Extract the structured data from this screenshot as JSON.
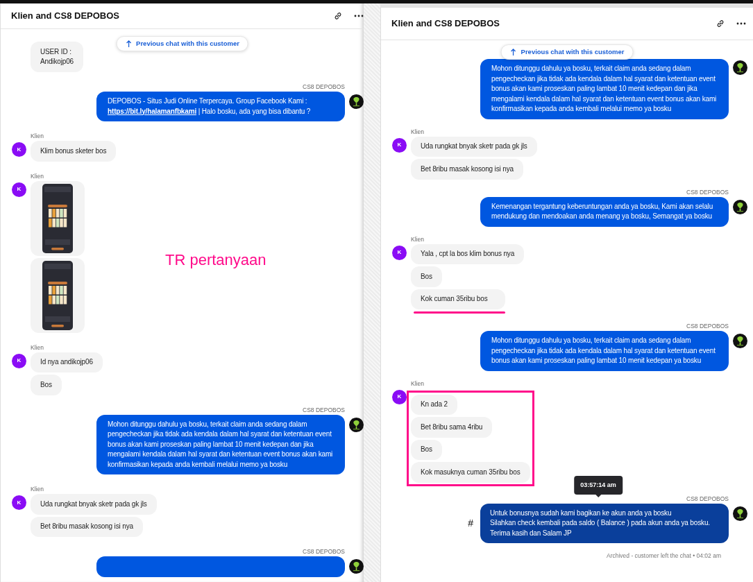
{
  "panels": [
    {
      "title": "Klien and CS8 DEPOBOS",
      "previous_chat_button": "Previous chat with this customer",
      "note": "TR pertanyaan",
      "groups": [
        {
          "kind": "client",
          "avatar": false,
          "boxed": false,
          "hovered": false,
          "bubbles": [
            {
              "kind": "text",
              "text": "USER ID :\nAndikojp06"
            }
          ]
        },
        {
          "kind": "agent",
          "avatar": true,
          "sender": "CS8 DEPOBOS",
          "boxed": false,
          "hovered": false,
          "bubbles": [
            {
              "kind": "link_text",
              "text": "DEPOBOS - Situs Judi Online Terpercaya. Group Facebook Kami :",
              "link": "https://bit.ly/halamanfbkami",
              "after": "| Halo bosku, ada yang bisa dibantu ?"
            }
          ]
        },
        {
          "kind": "client",
          "avatar": true,
          "initial": "K",
          "sender": "Klien",
          "boxed": false,
          "hovered": false,
          "bubbles": [
            {
              "kind": "text",
              "text": "Klim bonus sketer bos"
            }
          ]
        },
        {
          "kind": "client",
          "avatar": true,
          "initial": "K",
          "sender": "Klien",
          "boxed": false,
          "hovered": false
        },
        {
          "kind": "client",
          "avatar": true,
          "initial": "K",
          "sender": "Klien",
          "boxed": false,
          "hovered": false,
          "bubbles": [
            {
              "kind": "text",
              "text": "Id nya andikojp06"
            },
            {
              "kind": "text",
              "text": "Bos"
            }
          ]
        },
        {
          "kind": "agent",
          "avatar": true,
          "sender": "CS8 DEPOBOS",
          "boxed": false,
          "hovered": false,
          "bubbles": [
            {
              "kind": "text",
              "text": "Mohon ditunggu dahulu ya bosku, terkait claim anda sedang dalam pengecheckan jika tidak ada kendala dalam hal syarat dan ketentuan event bonus akan kami proseskan paling lambat 10 menit kedepan dan jika mengalami kendala dalam hal syarat dan ketentuan event bonus akan kami konfirmasikan kepada anda kembali melalui memo ya bosku"
            }
          ]
        },
        {
          "kind": "client",
          "avatar": true,
          "initial": "K",
          "sender": "Klien",
          "boxed": false,
          "hovered": false,
          "bubbles": [
            {
              "kind": "text",
              "text": "Uda rungkat bnyak sketr pada gk jls"
            },
            {
              "kind": "text",
              "text": "Bet 8ribu masak kosong isi nya"
            }
          ]
        },
        {
          "kind": "agent",
          "avatar": true,
          "sender": "CS8 DEPOBOS",
          "boxed": false,
          "hovered": false,
          "bubbles": [
            {
              "kind": "cut"
            }
          ]
        }
      ]
    },
    {
      "title": "Klien and CS8 DEPOBOS",
      "previous_chat_button": "Previous chat with this customer",
      "footer": "Archived - customer left the chat • 04:02 am",
      "groups": [
        {
          "kind": "agent",
          "avatar": true,
          "boxed": false,
          "hovered": false,
          "bubbles": [
            {
              "kind": "text",
              "text": "Mohon ditunggu dahulu ya bosku, terkait claim anda sedang dalam pengecheckan jika tidak ada kendala dalam hal syarat dan ketentuan event bonus akan kami proseskan paling lambat 10 menit kedepan dan jika mengalami kendala dalam hal syarat dan ketentuan event bonus akan kami konfirmasikan kepada anda kembali melalui memo ya bosku"
            }
          ]
        },
        {
          "kind": "client",
          "avatar": true,
          "initial": "K",
          "sender": "Klien",
          "boxed": false,
          "hovered": false,
          "bubbles": [
            {
              "kind": "text",
              "text": "Uda rungkat bnyak sketr pada gk jls"
            },
            {
              "kind": "text",
              "text": "Bet 8ribu masak kosong isi nya"
            }
          ]
        },
        {
          "kind": "agent",
          "avatar": true,
          "sender": "CS8 DEPOBOS",
          "boxed": false,
          "hovered": false,
          "bubbles": [
            {
              "kind": "text",
              "text": "Kemenangan tergantung keberuntungan anda ya bosku, Kami akan selalu mendukung dan mendoakan anda menang ya bosku, Semangat ya bosku"
            }
          ]
        },
        {
          "kind": "client",
          "avatar": true,
          "initial": "K",
          "sender": "Klien",
          "boxed": false,
          "hovered": false,
          "bubbles": [
            {
              "kind": "text",
              "text": "Yala , cpt la bos klim bonus nya",
              "underlined": false
            },
            {
              "kind": "text",
              "text": "Bos",
              "underlined": false
            },
            {
              "kind": "text",
              "text": "Kok cuman 35ribu bos",
              "underlined": true
            }
          ]
        },
        {
          "kind": "agent",
          "avatar": true,
          "sender": "CS8 DEPOBOS",
          "boxed": false,
          "hovered": false,
          "bubbles": [
            {
              "kind": "text",
              "text": "Mohon ditunggu dahulu ya bosku, terkait claim anda sedang dalam pengecheckan jika tidak ada kendala dalam hal syarat dan ketentuan event bonus akan kami proseskan paling lambat 10 menit kedepan ya bosku"
            }
          ]
        },
        {
          "kind": "client",
          "avatar": true,
          "initial": "K",
          "sender": "Klien",
          "boxed": true,
          "hovered": false,
          "bubbles": [
            {
              "kind": "text",
              "text": "Kn ada 2"
            },
            {
              "kind": "text",
              "text": "Bet 8ribu sama 4ribu"
            },
            {
              "kind": "text",
              "text": "Bos"
            },
            {
              "kind": "text",
              "text": "Kok masuknya cuman 35ribu bos"
            }
          ]
        },
        {
          "kind": "agent",
          "avatar": true,
          "sender": "CS8 DEPOBOS",
          "boxed": false,
          "hovered": true,
          "tooltip": "03:57:14 am",
          "marker": "#",
          "bubbles": [
            {
              "kind": "text",
              "text": "Untuk bonusnya sudah kami bagikan ke akun anda ya bosku\nSilahkan check kembali pada saldo ( Balance ) pada akun anda ya bosku.\nTerima kasih dan Salam JP"
            }
          ]
        }
      ]
    }
  ]
}
